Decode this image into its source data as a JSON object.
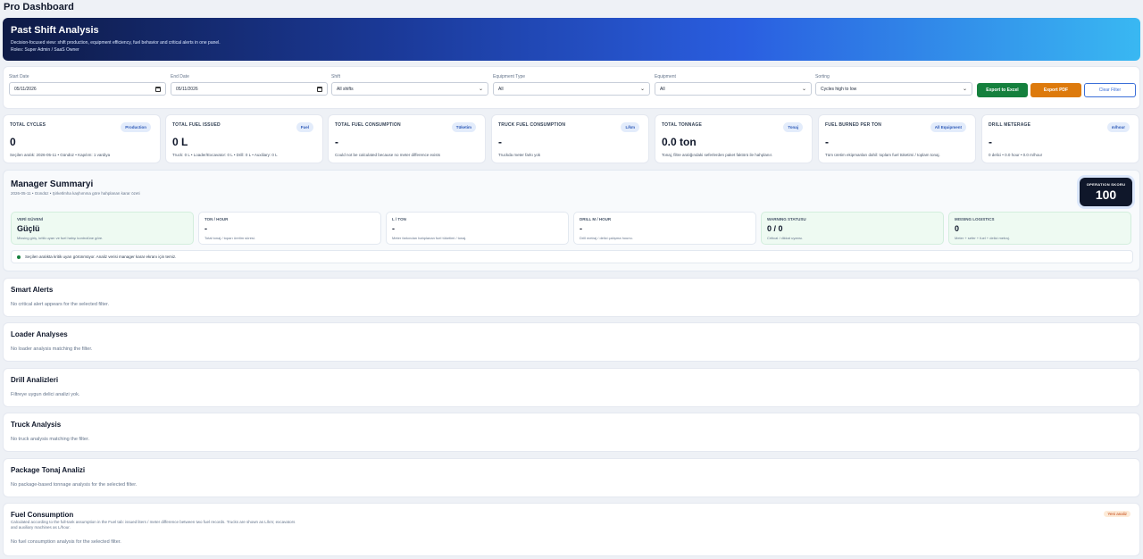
{
  "app": {
    "title": "Pro Dashboard"
  },
  "hero": {
    "title": "Past Shift Analysis",
    "description": "Decision-focused view: shift production, equipment efficiency, fuel behavior and critical alerts in one panel.",
    "roles": "Roles: Super Admin / SaaS Owner"
  },
  "filters": {
    "start_date": {
      "label": "Start Date",
      "value": "05/11/2026"
    },
    "end_date": {
      "label": "End Date",
      "value": "05/11/2026"
    },
    "shift": {
      "label": "Shift",
      "value": "All shifts"
    },
    "equipment_type": {
      "label": "Equipment Type",
      "value": "All"
    },
    "equipment": {
      "label": "Equipment",
      "value": "All"
    },
    "sorting": {
      "label": "Sorting",
      "value": "Cycles high to low"
    },
    "export_excel": "Export to Excel",
    "export_pdf": "Export PDF",
    "clear_filter": "Clear Filter"
  },
  "kpis": [
    {
      "title": "TOTAL CYCLES",
      "badge": "Production",
      "value": "0",
      "sub": "Seçilen aralık: 2026-05-11 • Gündüz • Kapılım: 1 vardiya"
    },
    {
      "title": "TOTAL FUEL ISSUED",
      "badge": "Fuel",
      "value": "0 L",
      "sub": "Truck: 0 L • Loader/Excavator: 0 L • Drill: 0 L • Auxiliary: 0 L"
    },
    {
      "title": "TOTAL FUEL CONSUMPTION",
      "badge": "Tüketim",
      "value": "-",
      "sub": "Could not be calculated because no meter difference exists"
    },
    {
      "title": "TRUCK FUEL CONSUMPTION",
      "badge": "L/km",
      "value": "-",
      "sub": "Truckda meter farkı yok"
    },
    {
      "title": "TOTAL TONNAGE",
      "badge": "Tonaj",
      "value": "0.0 ton",
      "sub": "Tonaj, filtre aralığındaki seferlerden paket faktörü ile hahplanır."
    },
    {
      "title": "FUEL BURNED PER TON",
      "badge": "All Equipment",
      "value": "-",
      "sub": "Tüm üretim ekipmanları dahil: toplam fuel tüketimi / toplam tonaj."
    },
    {
      "title": "DRILL METERAGE",
      "badge": "m/hour",
      "value": "-",
      "sub": "0 delici • 0.0 hour • 0.0 m/hour"
    }
  ],
  "manager": {
    "title": "Manager Summaryi",
    "subtitle": "2026-05-11 • Gündüz • Şirketlmha kaşhımma göre hahplanan karar özeti",
    "score_label": "OPERATION SKORU",
    "score_value": "100",
    "cards": [
      {
        "title": "VERİ GÜVENİ",
        "value": "Güçlü",
        "sub": "Missing giriş, kritik uyarı ve fuel hahşı kontrolüne göre."
      },
      {
        "title": "TON / HOUR",
        "value": "-",
        "sub": "Total tonaj / toparı üretim süresi."
      },
      {
        "title": "L / TON",
        "value": "-",
        "sub": "Meter farkından hahplanan fuel tüketimi / tonaj."
      },
      {
        "title": "DRILL M / HOUR",
        "value": "-",
        "sub": "Drill metraj / delici çalışma hoursı."
      },
      {
        "title": "WARNING STATUSU",
        "value": "0 / 0",
        "sub": "Critical / dikkat uyarısı."
      },
      {
        "title": "MISSING LOGISTICS",
        "value": "0",
        "sub": "Meter + sefer + fuel + delici metraj."
      }
    ],
    "note": "Seçilen aralıkta kritik uyarı görünmüyor. Analiz verisi manager karar ekranı için temiz."
  },
  "sections": {
    "smart_alerts": {
      "title": "Smart Alerts",
      "empty": "No critical alert appears for the selected filter."
    },
    "loader": {
      "title": "Loader Analyses",
      "empty": "No loader analysis matching the filter."
    },
    "drill": {
      "title": "Drill Analizleri",
      "empty": "Filtreye uygun delici analizi yok."
    },
    "truck": {
      "title": "Truck Analysis",
      "empty": "No truck analysis matching the filter."
    },
    "package": {
      "title": "Package Tonaj Analizi",
      "empty": "No package-based tonnage analysis for the selected filter."
    },
    "fuel": {
      "title": "Fuel Consumption",
      "description": "Calculated according to the full-tank assumption in the Fuel tab: issued liters / meter difference between two fuel records. Trucks are shown as L/km; excavators and auxiliary machines as L/hour.",
      "tag": "Yeni analiz",
      "empty": "No fuel consumption analysis for the selected filter."
    }
  }
}
